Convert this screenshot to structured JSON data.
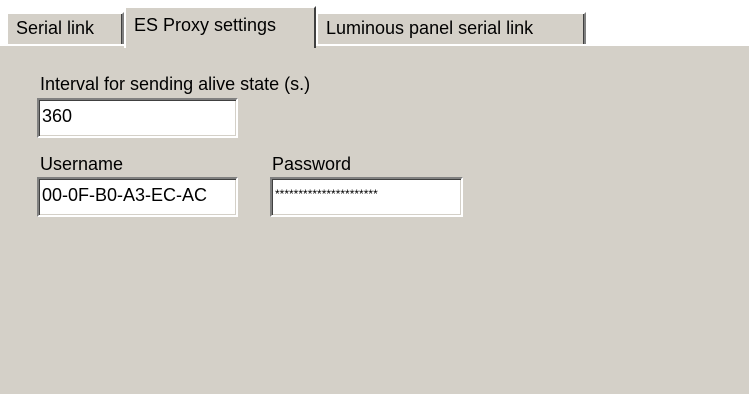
{
  "tabs": [
    {
      "label": "Serial link",
      "active": false
    },
    {
      "label": "ES Proxy settings",
      "active": true
    },
    {
      "label": "Luminous panel serial link",
      "active": false
    }
  ],
  "form": {
    "interval_label": "Interval for sending alive state (s.)",
    "interval_value": "360",
    "username_label": "Username",
    "username_value": "00-0F-B0-A3-EC-AC",
    "password_label": "Password",
    "password_value": "**********************"
  }
}
